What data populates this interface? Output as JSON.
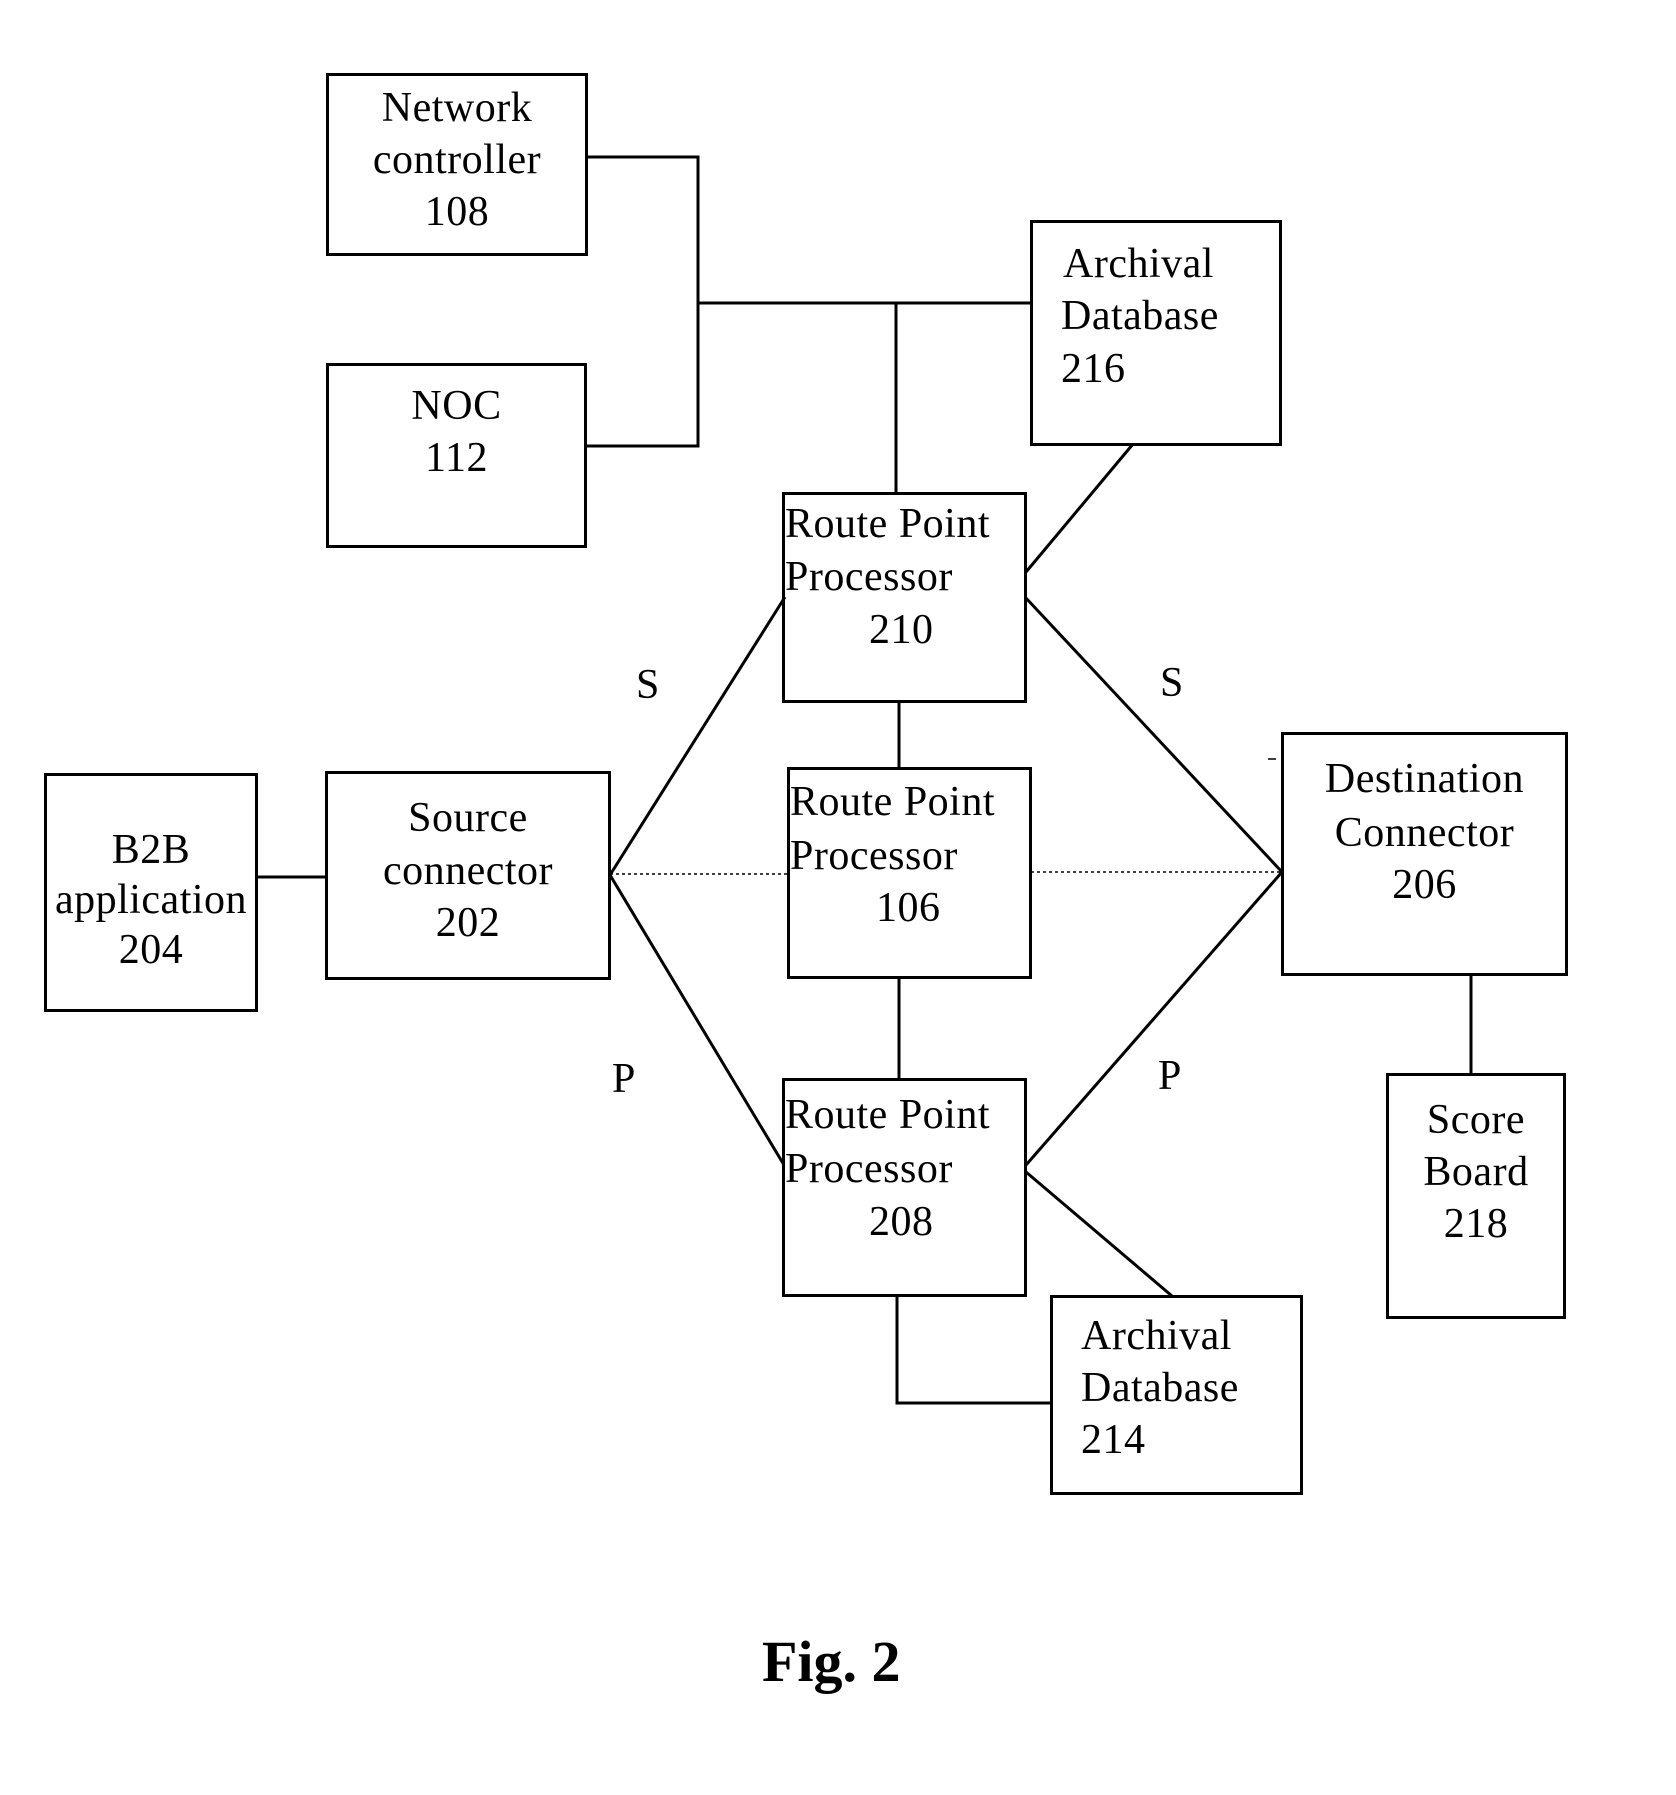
{
  "figure": {
    "caption": "Fig. 2",
    "nodes": {
      "network_controller": {
        "lines": [
          "Network",
          "controller",
          "108"
        ]
      },
      "noc": {
        "lines": [
          "NOC",
          "112"
        ]
      },
      "archival_216": {
        "lines": [
          "Archival",
          "Database",
          "216"
        ]
      },
      "rpp_210": {
        "lines": [
          "Route Point",
          "Processor",
          "210"
        ]
      },
      "rpp_106": {
        "lines": [
          "Route Point",
          "Processor",
          "106"
        ]
      },
      "rpp_208": {
        "lines": [
          "Route Point",
          "Processor",
          "208"
        ]
      },
      "b2b": {
        "lines": [
          "B2B",
          "application",
          "204"
        ]
      },
      "source": {
        "lines": [
          "Source",
          "connector",
          "202"
        ]
      },
      "destination": {
        "lines": [
          "Destination",
          "Connector",
          "206"
        ]
      },
      "scoreboard": {
        "lines": [
          "Score",
          "Board",
          "218"
        ]
      },
      "archival_214": {
        "lines": [
          "Archival",
          "Database",
          "214"
        ]
      }
    },
    "edge_labels": {
      "s_left": "S",
      "s_right": "S",
      "p_left": "P",
      "p_right": "P"
    },
    "edges": [
      {
        "from": "network_controller",
        "to": "bus",
        "style": "solid"
      },
      {
        "from": "noc",
        "to": "bus",
        "style": "solid"
      },
      {
        "from": "bus",
        "to": "archival_216",
        "style": "solid"
      },
      {
        "from": "bus",
        "to": "rpp_210",
        "style": "solid"
      },
      {
        "from": "archival_216",
        "to": "rpp_210",
        "style": "solid"
      },
      {
        "from": "b2b",
        "to": "source",
        "style": "solid"
      },
      {
        "from": "source",
        "to": "rpp_210",
        "style": "solid",
        "label": "S"
      },
      {
        "from": "source",
        "to": "rpp_106",
        "style": "dotted"
      },
      {
        "from": "source",
        "to": "rpp_208",
        "style": "solid",
        "label": "P"
      },
      {
        "from": "rpp_210",
        "to": "rpp_106",
        "style": "solid"
      },
      {
        "from": "rpp_106",
        "to": "rpp_208",
        "style": "solid"
      },
      {
        "from": "rpp_210",
        "to": "destination",
        "style": "solid",
        "label": "S"
      },
      {
        "from": "rpp_106",
        "to": "destination",
        "style": "dotted"
      },
      {
        "from": "rpp_208",
        "to": "destination",
        "style": "solid",
        "label": "P"
      },
      {
        "from": "rpp_208",
        "to": "archival_214",
        "style": "solid"
      },
      {
        "from": "rpp_208",
        "to": "archival_214",
        "style": "solid",
        "via": "bracket"
      },
      {
        "from": "destination",
        "to": "scoreboard",
        "style": "solid"
      }
    ]
  }
}
